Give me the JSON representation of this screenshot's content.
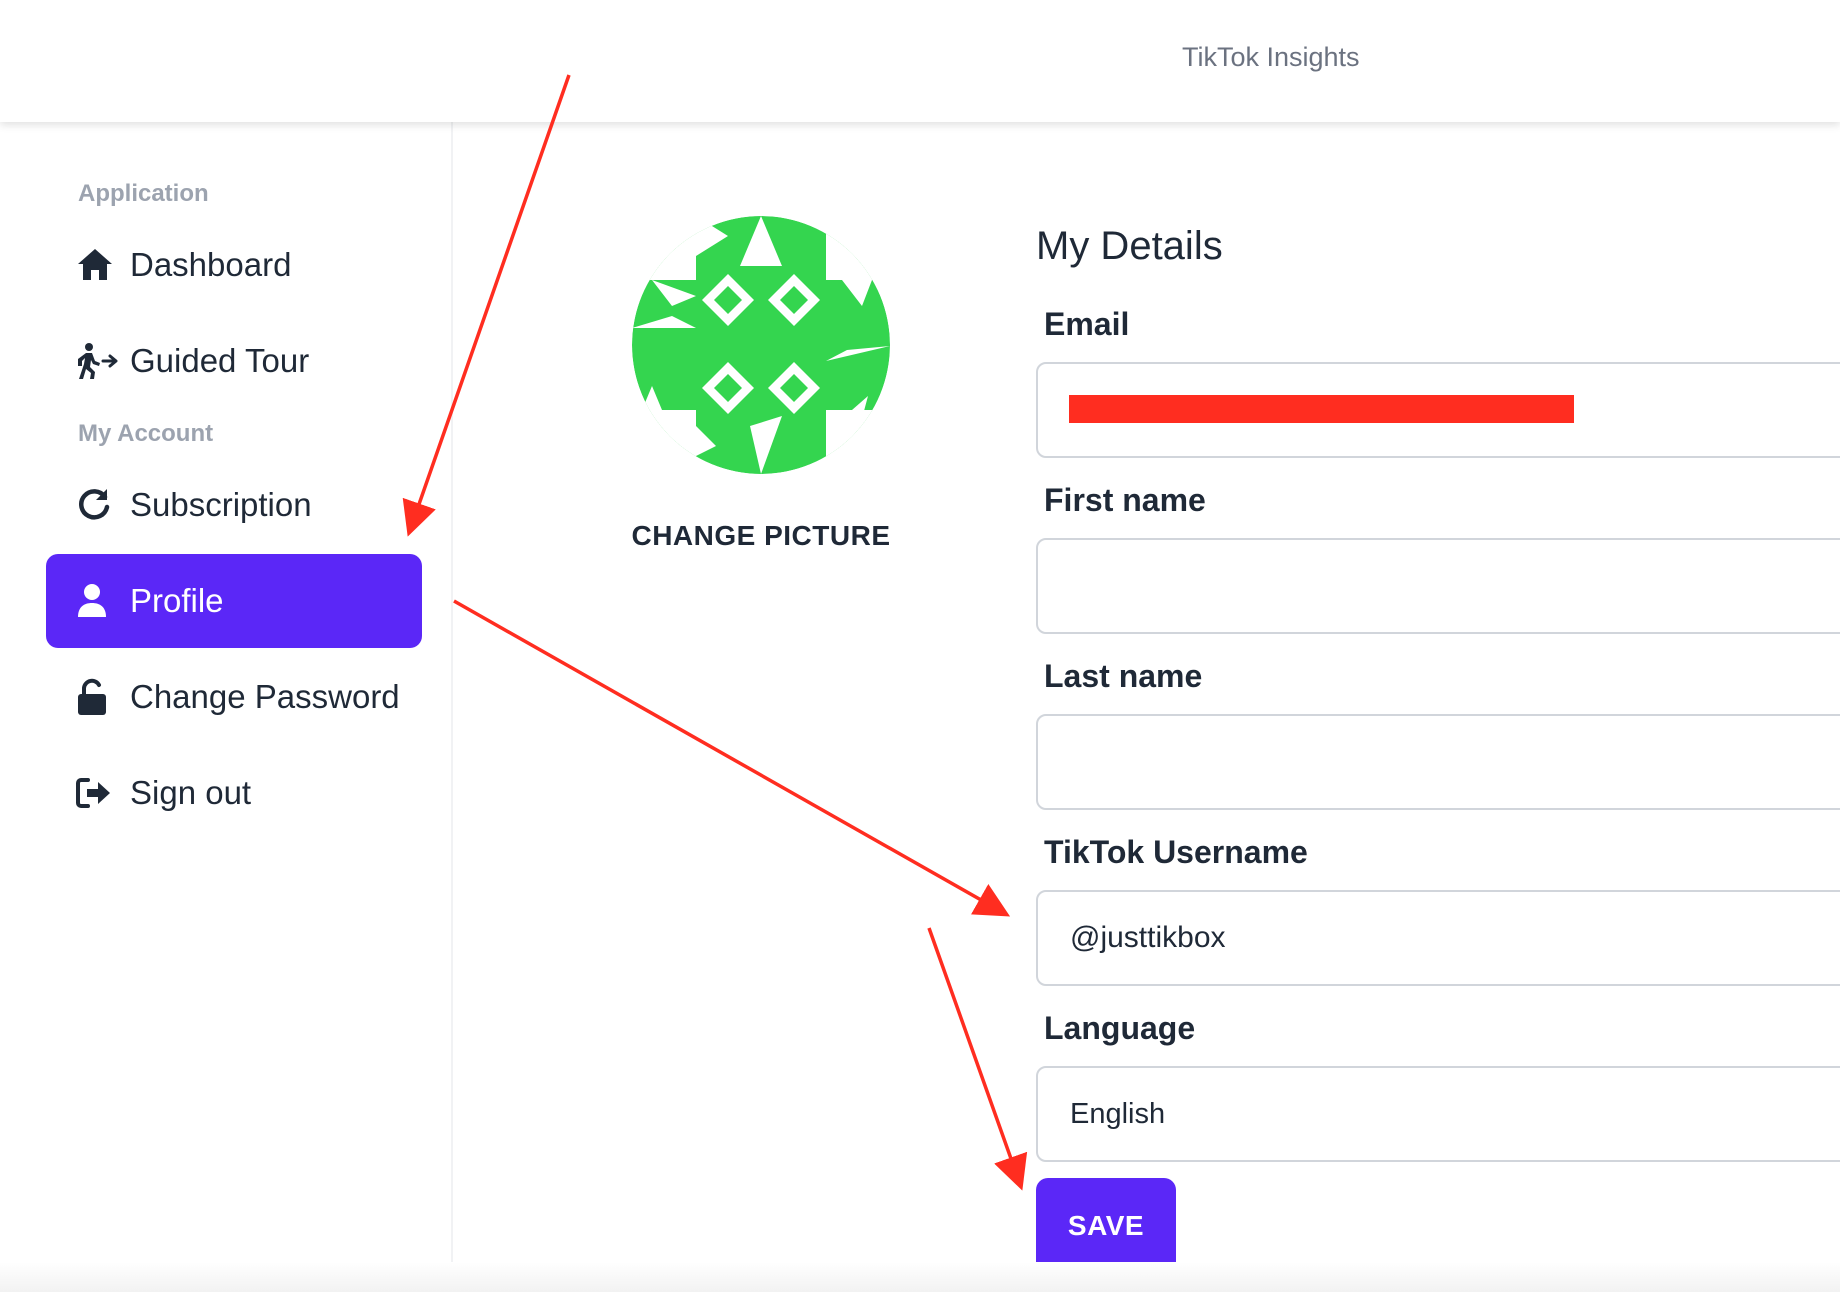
{
  "header": {
    "title": "TikTok Insights"
  },
  "sidebar": {
    "sections": [
      {
        "label": "Application"
      },
      {
        "label": "My Account"
      }
    ],
    "items": [
      {
        "label": "Dashboard",
        "icon": "home-icon"
      },
      {
        "label": "Guided Tour",
        "icon": "walking-person-icon"
      },
      {
        "label": "Subscription",
        "icon": "refresh-icon"
      },
      {
        "label": "Profile",
        "icon": "user-icon",
        "active": true
      },
      {
        "label": "Change Password",
        "icon": "unlock-icon"
      },
      {
        "label": "Sign out",
        "icon": "sign-out-icon"
      }
    ]
  },
  "profile": {
    "change_picture_label": "CHANGE PICTURE",
    "avatar_color": "#34d54f"
  },
  "form": {
    "title": "My Details",
    "fields": {
      "email": {
        "label": "Email",
        "value": "",
        "redacted": true
      },
      "first_name": {
        "label": "First name",
        "value": ""
      },
      "last_name": {
        "label": "Last name",
        "value": ""
      },
      "tiktok_username": {
        "label": "TikTok Username",
        "value": "@justtikbox"
      },
      "language": {
        "label": "Language",
        "value": "English"
      }
    },
    "save_label": "SAVE"
  },
  "colors": {
    "accent": "#5b27f7",
    "annotation": "#ff2d20"
  }
}
